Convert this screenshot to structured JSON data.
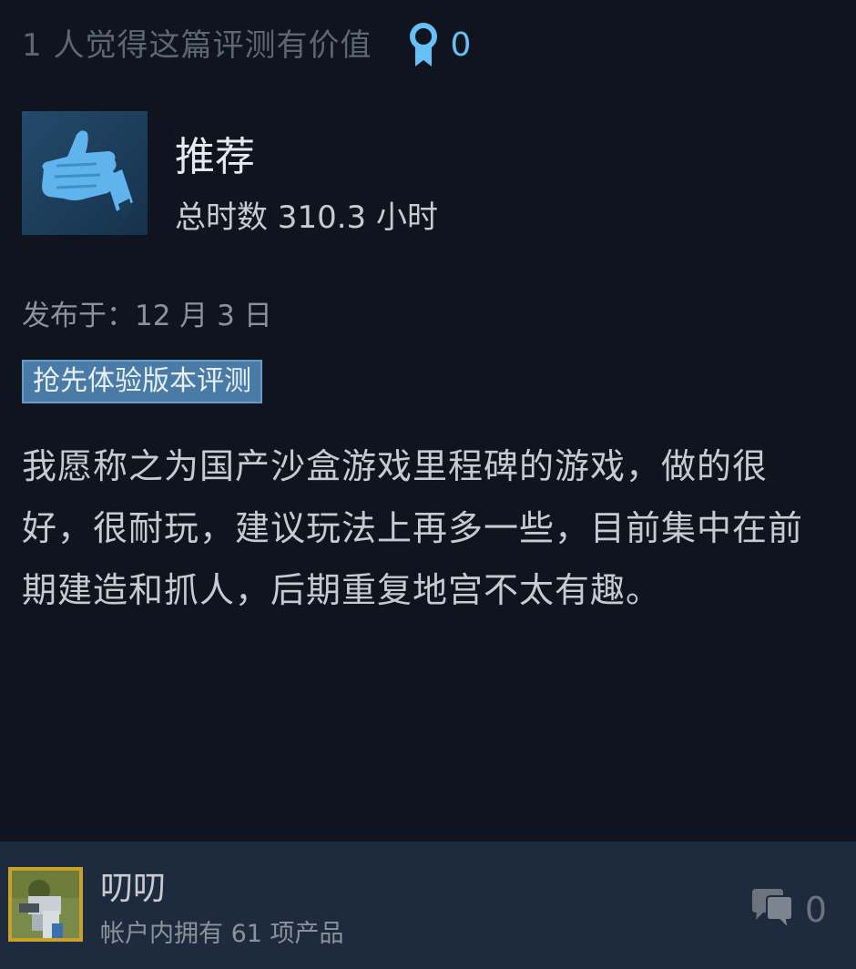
{
  "review": {
    "helpful_text": "1 人觉得这篇评测有价值",
    "award_count": "0",
    "recommendation": "推荐",
    "playtime": "总时数 310.3 小时",
    "posted": "发布于：12 月 3 日",
    "early_access_badge": "抢先体验版本评测",
    "body": "我愿称之为国产沙盒游戏里程碑的游戏，做的很好，很耐玩，建议玩法上再多一些，目前集中在前期建造和抓人，后期重复地宫不太有趣。"
  },
  "author": {
    "name": "叨叨",
    "products": "帐户内拥有 61 项产品"
  },
  "footer": {
    "comment_count": "0"
  },
  "colors": {
    "background": "#0f141e",
    "footer_bg": "#1e2a3d",
    "accent": "#66c0f4",
    "badge_bg": "#4a7aa6"
  },
  "icons": {
    "award": "award-ribbon-icon",
    "thumb": "thumbs-up-icon",
    "comment": "comment-bubble-icon"
  }
}
